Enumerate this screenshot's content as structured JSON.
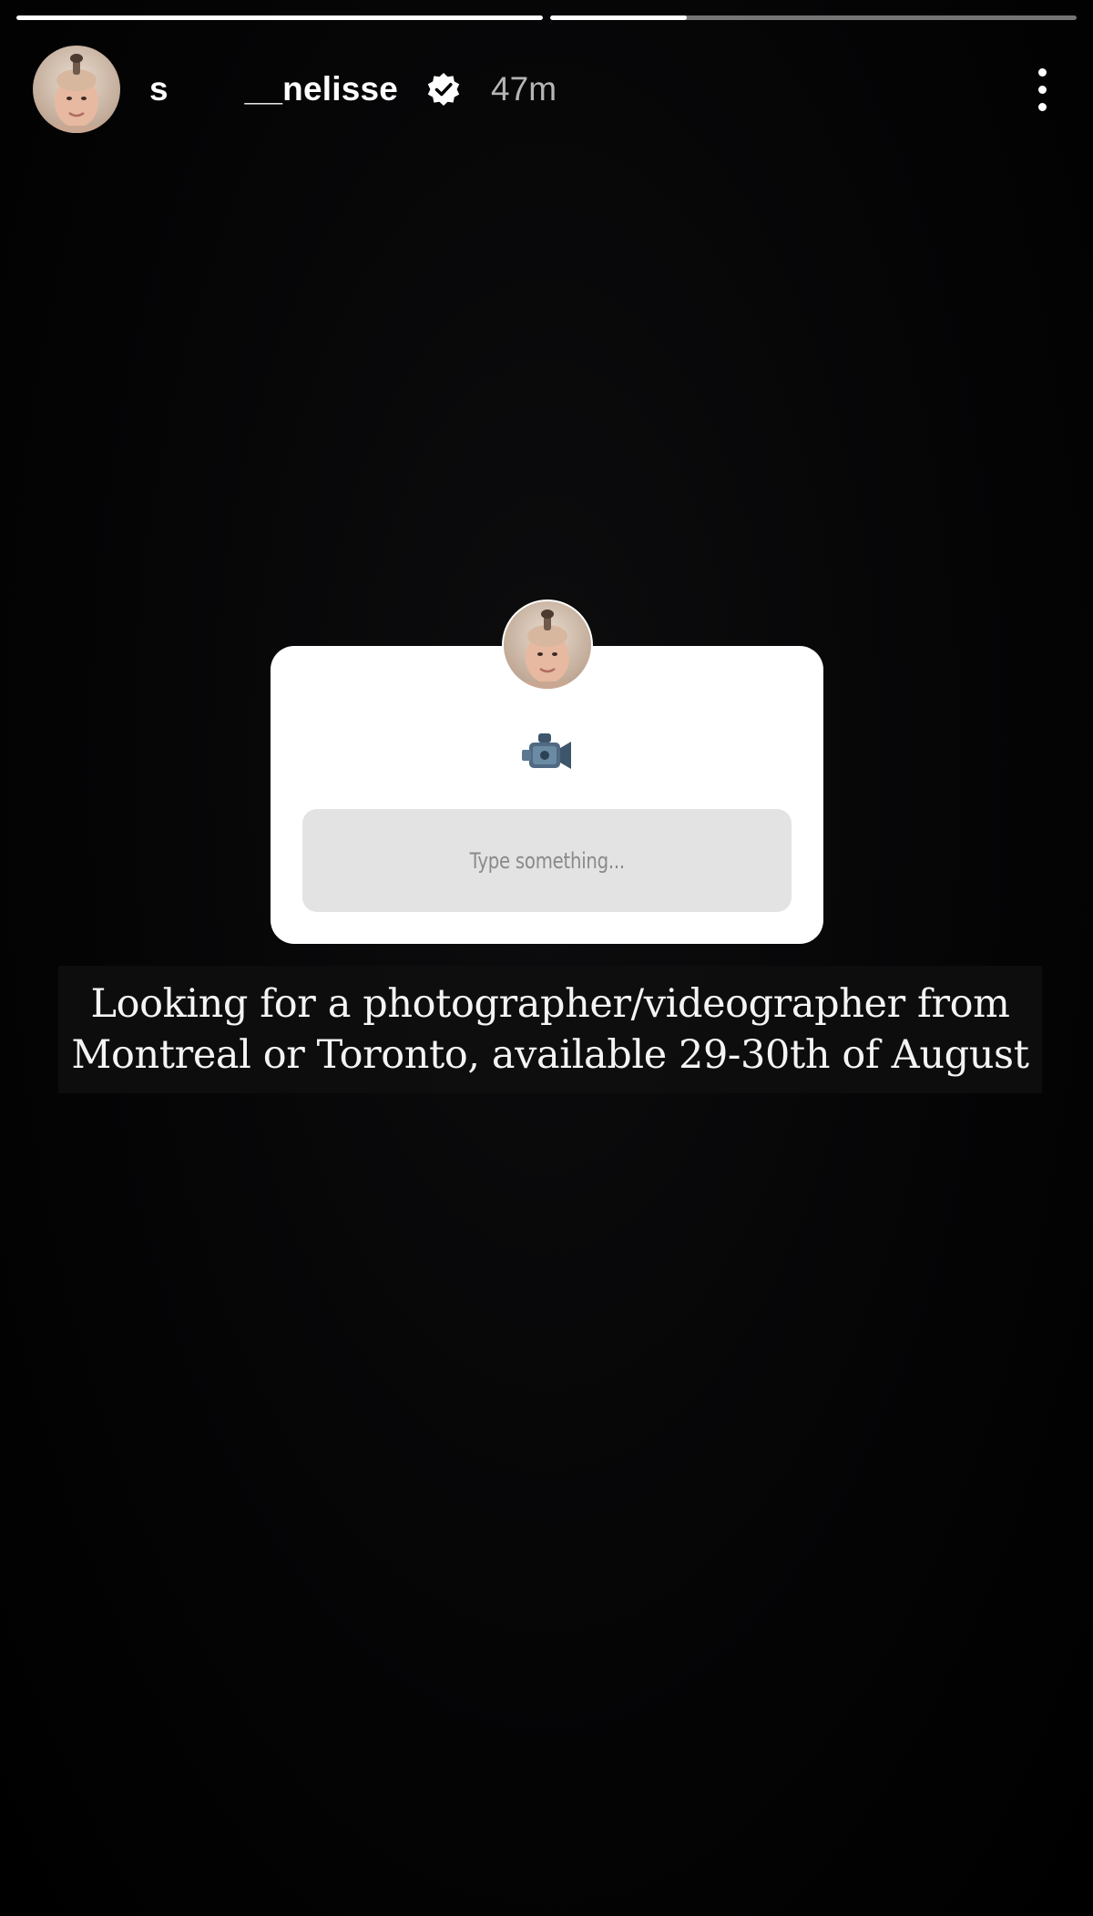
{
  "story": {
    "progress": [
      {
        "segment": 1,
        "fraction": 1.0
      },
      {
        "segment": 2,
        "fraction": 0.26
      }
    ],
    "header": {
      "username": "s        __nelisse",
      "time_ago": "47m",
      "verified_icon": "verified-badge-icon",
      "more_icon": "more-vertical-icon"
    },
    "sticker": {
      "emoji": "📹",
      "input_placeholder": "Type something..."
    },
    "caption": {
      "line1": "Looking for a photographer/videographer from",
      "line2": "Montreal or Toronto, available 29-30th of August"
    }
  },
  "colors": {
    "background": "#000000",
    "sticker_bg": "#ffffff",
    "input_bg": "#e3e3e3",
    "placeholder_text": "#8a8a8a"
  }
}
